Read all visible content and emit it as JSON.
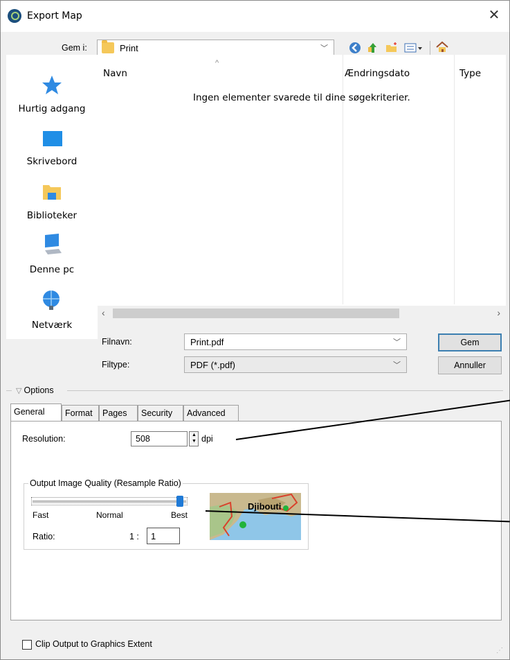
{
  "window": {
    "title": "Export Map",
    "close": "✕"
  },
  "save_in": {
    "label": "Gem i:",
    "value": "Print"
  },
  "places": [
    {
      "label": "Hurtig adgang",
      "icon": "star-icon"
    },
    {
      "label": "Skrivebord",
      "icon": "desktop-icon"
    },
    {
      "label": "Biblioteker",
      "icon": "libraries-icon"
    },
    {
      "label": "Denne pc",
      "icon": "computer-icon"
    },
    {
      "label": "Netværk",
      "icon": "network-icon"
    }
  ],
  "file_list": {
    "columns": [
      "Navn",
      "Ændringsdato",
      "Type"
    ],
    "empty_message": "Ingen elementer svarede til dine søgekriterier."
  },
  "filename": {
    "label": "Filnavn:",
    "value": "Print.pdf"
  },
  "filetype": {
    "label": "Filtype:",
    "value": "PDF (*.pdf)"
  },
  "buttons": {
    "save": "Gem",
    "cancel": "Annuller"
  },
  "options": {
    "label": "Options"
  },
  "tabs": [
    "General",
    "Format",
    "Pages",
    "Security",
    "Advanced"
  ],
  "general": {
    "resolution_label": "Resolution:",
    "resolution_value": "508",
    "resolution_unit": "dpi",
    "quality_group": "Output Image Quality (Resample Ratio)",
    "slider_fast": "Fast",
    "slider_normal": "Normal",
    "slider_best": "Best",
    "slider_level": 1.0,
    "ratio_label": "Ratio:",
    "ratio_prefix": "1 :",
    "ratio_value": "1",
    "preview_label": "Djibouti"
  },
  "clip_output": {
    "label": "Clip Output to Graphics Extent",
    "checked": false
  }
}
